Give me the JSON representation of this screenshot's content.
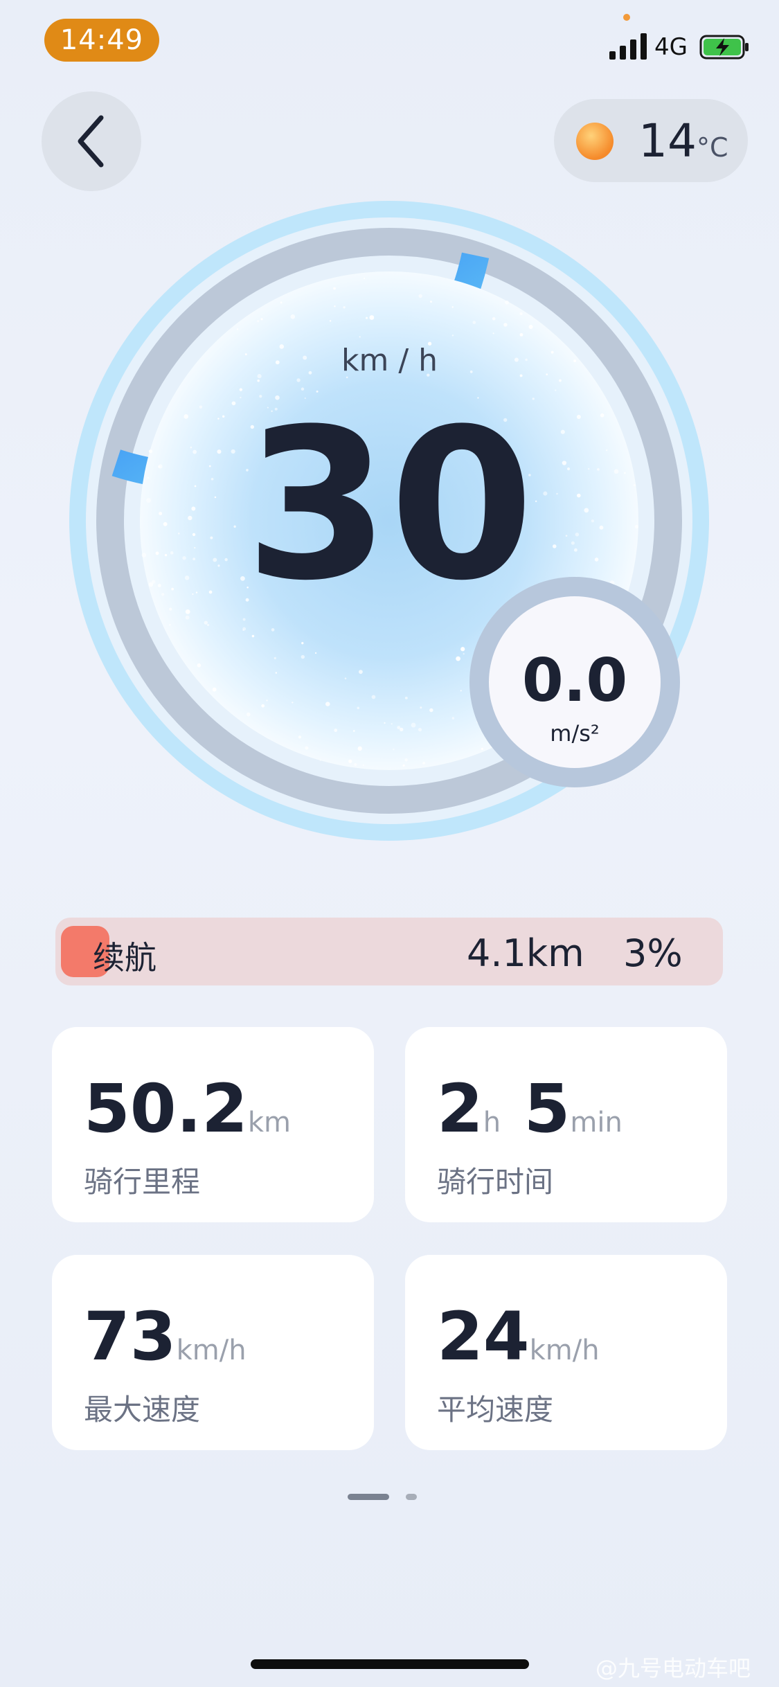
{
  "status_bar": {
    "time": "14:49",
    "network": "4G"
  },
  "weather": {
    "temperature": "14",
    "unit": "°C"
  },
  "speedometer": {
    "unit": "km / h",
    "speed": "30",
    "speed_fraction": 0.3
  },
  "acceleration": {
    "value": "0.0",
    "unit": "m/s²"
  },
  "range": {
    "label": "续航",
    "distance": "4.1km",
    "battery_percent": "3%"
  },
  "stats": [
    {
      "value": "50.2",
      "unit": "km",
      "label": "骑行里程"
    },
    {
      "value": "2",
      "unit": "h",
      "value2": "5",
      "unit2": "min",
      "label": "骑行时间"
    },
    {
      "value": "73",
      "unit": "km/h",
      "label": "最大速度"
    },
    {
      "value": "24",
      "unit": "km/h",
      "label": "平均速度"
    }
  ],
  "watermark": "@九号电动车吧",
  "colors": {
    "accent_blue": "#2f7df5",
    "range_fill": "#f37a6a",
    "time_pill": "#e08a16"
  }
}
